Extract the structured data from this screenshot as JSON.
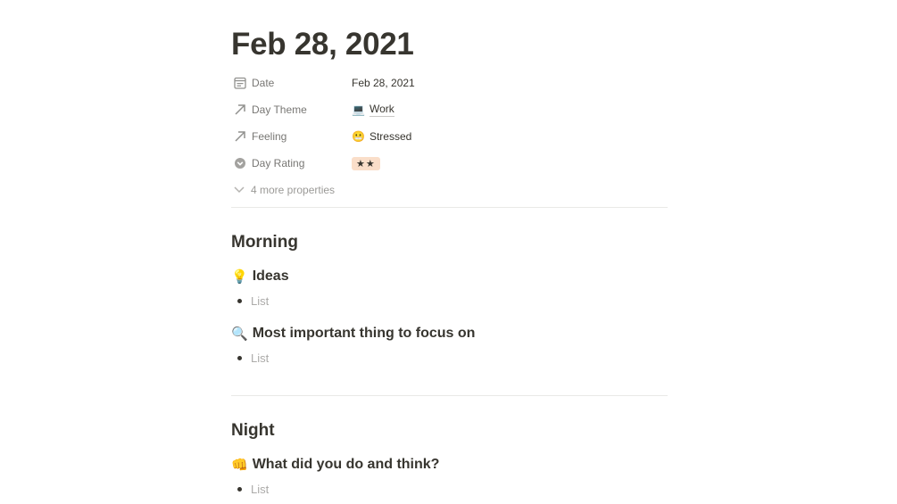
{
  "page": {
    "title": "Feb 28, 2021"
  },
  "properties": [
    {
      "label": "Date",
      "value": "Feb 28, 2021",
      "icon": "calendar-icon"
    },
    {
      "label": "Day Theme",
      "value": "Work",
      "emoji": "💻",
      "icon": "relation-arrow-icon"
    },
    {
      "label": "Feeling",
      "value": "Stressed",
      "emoji": "😬",
      "icon": "relation-arrow-icon"
    },
    {
      "label": "Day Rating",
      "value": "★★",
      "icon": "select-icon"
    }
  ],
  "more_properties": {
    "label": "4 more properties",
    "icon": "chevron-down-icon"
  },
  "sections": {
    "morning": {
      "heading": "Morning",
      "ideas": {
        "emoji": "💡",
        "heading": "Ideas",
        "placeholder": "List"
      },
      "focus": {
        "emoji": "🔍",
        "heading": "Most important thing to focus on",
        "placeholder": "List"
      }
    },
    "night": {
      "heading": "Night",
      "reflect": {
        "emoji": "👊",
        "heading": "What did you do and think?",
        "placeholder": "List"
      }
    }
  },
  "colors": {
    "text": "#37352f",
    "muted": "#787774",
    "placeholder": "#acaba9",
    "divider": "#e9e9e7",
    "rating_tag": "#fadec9"
  }
}
